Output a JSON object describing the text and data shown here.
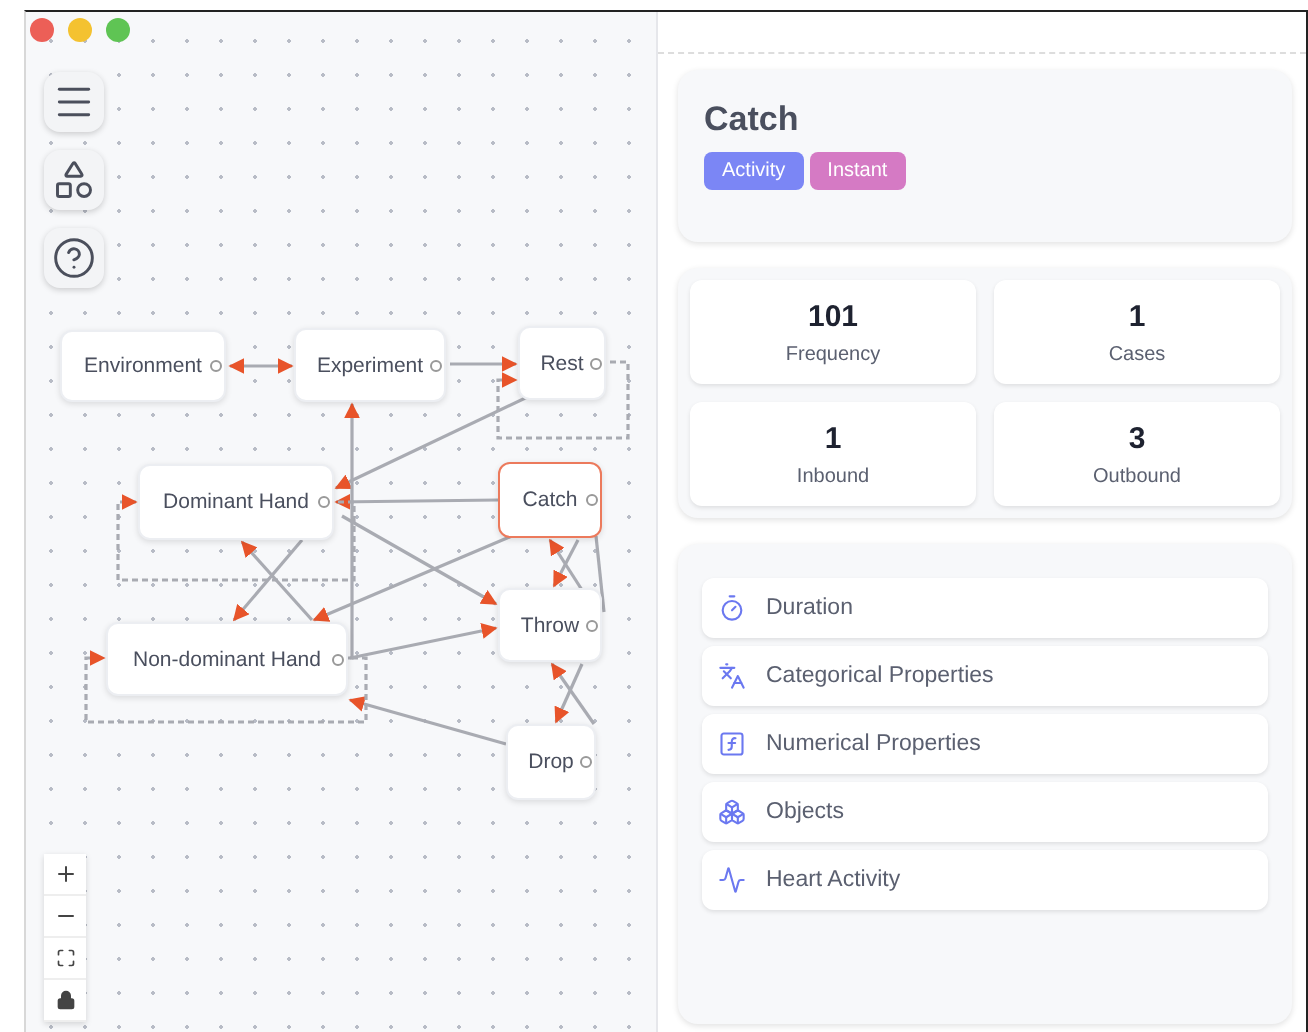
{
  "graph": {
    "nodes": [
      {
        "label": "Environment",
        "selected": false
      },
      {
        "label": "Experiment",
        "selected": false
      },
      {
        "label": "Rest",
        "selected": false
      },
      {
        "label": "Dominant Hand",
        "selected": false
      },
      {
        "label": "Catch",
        "selected": true
      },
      {
        "label": "Non-dominant Hand",
        "selected": false
      },
      {
        "label": "Throw",
        "selected": false
      },
      {
        "label": "Drop",
        "selected": false
      }
    ]
  },
  "detail": {
    "title": "Catch",
    "tags": [
      {
        "label": "Activity",
        "color": "#7b86f5"
      },
      {
        "label": "Instant",
        "color": "#d57ac4"
      }
    ],
    "stats": [
      {
        "value": "101",
        "label": "Frequency"
      },
      {
        "value": "1",
        "label": "Cases"
      },
      {
        "value": "1",
        "label": "Inbound"
      },
      {
        "value": "3",
        "label": "Outbound"
      }
    ],
    "properties": [
      {
        "label": "Duration",
        "kind": "duration"
      },
      {
        "label": "Categorical Properties",
        "kind": "categorical"
      },
      {
        "label": "Numerical Properties",
        "kind": "numerical"
      },
      {
        "label": "Objects",
        "kind": "objects"
      },
      {
        "label": "Heart Activity",
        "kind": "heart"
      }
    ]
  }
}
